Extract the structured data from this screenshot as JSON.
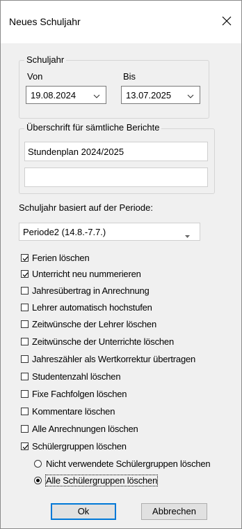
{
  "dialog": {
    "title": "Neues Schuljahr",
    "close_icon": "close-icon"
  },
  "schuljahr": {
    "legend": "Schuljahr",
    "von_label": "Von",
    "bis_label": "Bis",
    "von_value": "19.08.2024",
    "bis_value": "13.07.2025"
  },
  "berichte": {
    "legend": "Überschrift für sämtliche Berichte",
    "line1": "Stundenplan 2024/2025",
    "line2": ""
  },
  "periode": {
    "label": "Schuljahr basiert auf der Periode:",
    "value": "Periode2 (14.8.-7.7.)"
  },
  "options": [
    {
      "label": "Ferien löschen",
      "checked": true
    },
    {
      "label": "Unterricht neu nummerieren",
      "checked": true
    },
    {
      "label": "Jahresübertrag in Anrechnung",
      "checked": false
    },
    {
      "label": "Lehrer automatisch hochstufen",
      "checked": false
    },
    {
      "label": "Zeitwünsche der Lehrer löschen",
      "checked": false
    },
    {
      "label": "Zeitwünsche der Unterrichte löschen",
      "checked": false
    },
    {
      "label": "Jahreszähler als Wertkorrektur übertragen",
      "checked": false
    },
    {
      "label": "Studentenzahl löschen",
      "checked": false
    },
    {
      "label": "Fixe Fachfolgen löschen",
      "checked": false
    },
    {
      "label": "Kommentare löschen",
      "checked": false
    },
    {
      "label": "Alle Anrechnungen löschen",
      "checked": false
    },
    {
      "label": "Schülergruppen löschen",
      "checked": true
    }
  ],
  "radios": [
    {
      "label": "Nicht verwendete Schülergruppen löschen",
      "selected": false
    },
    {
      "label": "Alle Schülergruppen löschen",
      "selected": true
    }
  ],
  "buttons": {
    "ok": "Ok",
    "cancel": "Abbrechen"
  }
}
